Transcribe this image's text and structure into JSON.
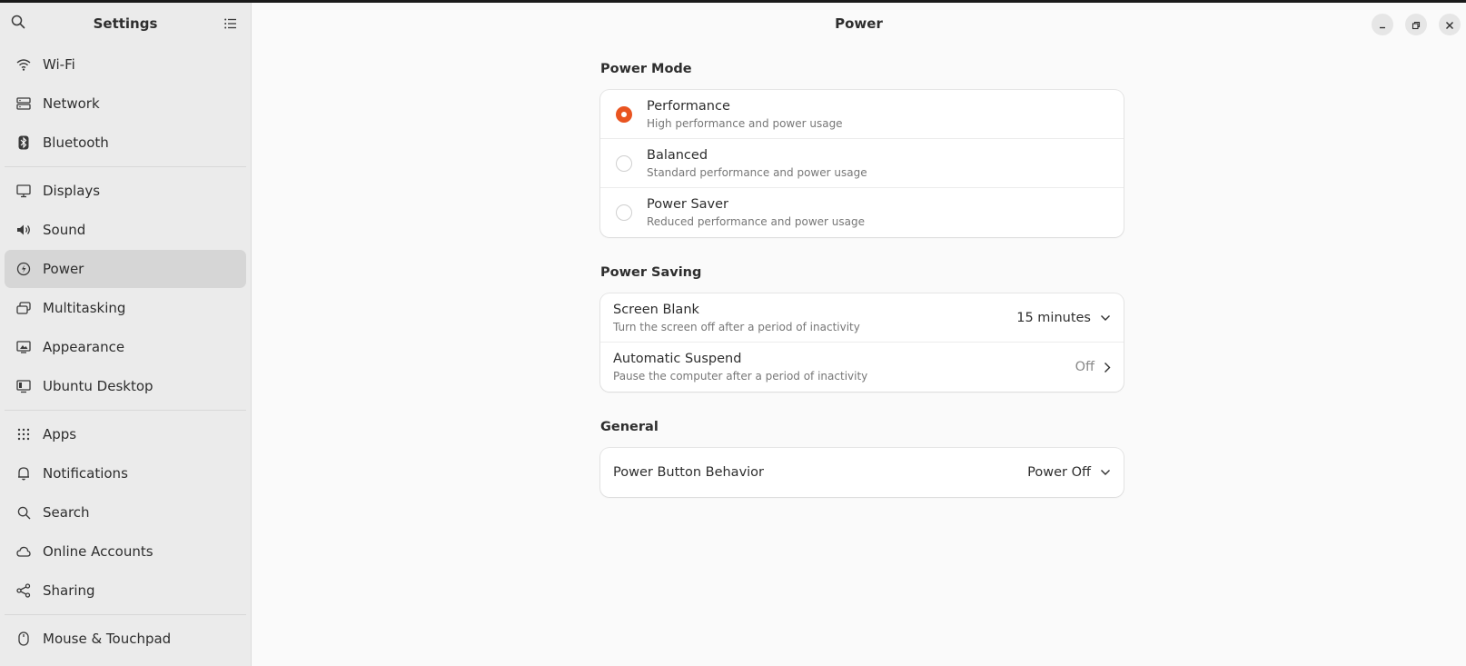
{
  "sidebar": {
    "title": "Settings",
    "items": [
      {
        "label": "Wi-Fi",
        "icon": "wifi-icon"
      },
      {
        "label": "Network",
        "icon": "network-icon"
      },
      {
        "label": "Bluetooth",
        "icon": "bluetooth-icon"
      },
      {
        "label": "Displays",
        "icon": "display-icon"
      },
      {
        "label": "Sound",
        "icon": "sound-icon"
      },
      {
        "label": "Power",
        "icon": "power-icon",
        "selected": true
      },
      {
        "label": "Multitasking",
        "icon": "multitasking-icon"
      },
      {
        "label": "Appearance",
        "icon": "appearance-icon"
      },
      {
        "label": "Ubuntu Desktop",
        "icon": "ubuntu-desktop-icon"
      },
      {
        "label": "Apps",
        "icon": "apps-icon"
      },
      {
        "label": "Notifications",
        "icon": "bell-icon"
      },
      {
        "label": "Search",
        "icon": "search-icon"
      },
      {
        "label": "Online Accounts",
        "icon": "cloud-icon"
      },
      {
        "label": "Sharing",
        "icon": "share-icon"
      },
      {
        "label": "Mouse & Touchpad",
        "icon": "mouse-icon"
      }
    ]
  },
  "header": {
    "title": "Power"
  },
  "power_mode": {
    "title": "Power Mode",
    "options": [
      {
        "label": "Performance",
        "description": "High performance and power usage",
        "checked": true
      },
      {
        "label": "Balanced",
        "description": "Standard performance and power usage",
        "checked": false
      },
      {
        "label": "Power Saver",
        "description": "Reduced performance and power usage",
        "checked": false
      }
    ]
  },
  "power_saving": {
    "title": "Power Saving",
    "screen_blank": {
      "label": "Screen Blank",
      "description": "Turn the screen off after a period of inactivity",
      "value": "15 minutes"
    },
    "automatic_suspend": {
      "label": "Automatic Suspend",
      "description": "Pause the computer after a period of inactivity",
      "value": "Off"
    }
  },
  "general": {
    "title": "General",
    "power_button": {
      "label": "Power Button Behavior",
      "value": "Power Off"
    }
  },
  "colors": {
    "accent": "#e95420",
    "sidebar_bg": "#ebebeb",
    "content_bg": "#fafafa"
  }
}
